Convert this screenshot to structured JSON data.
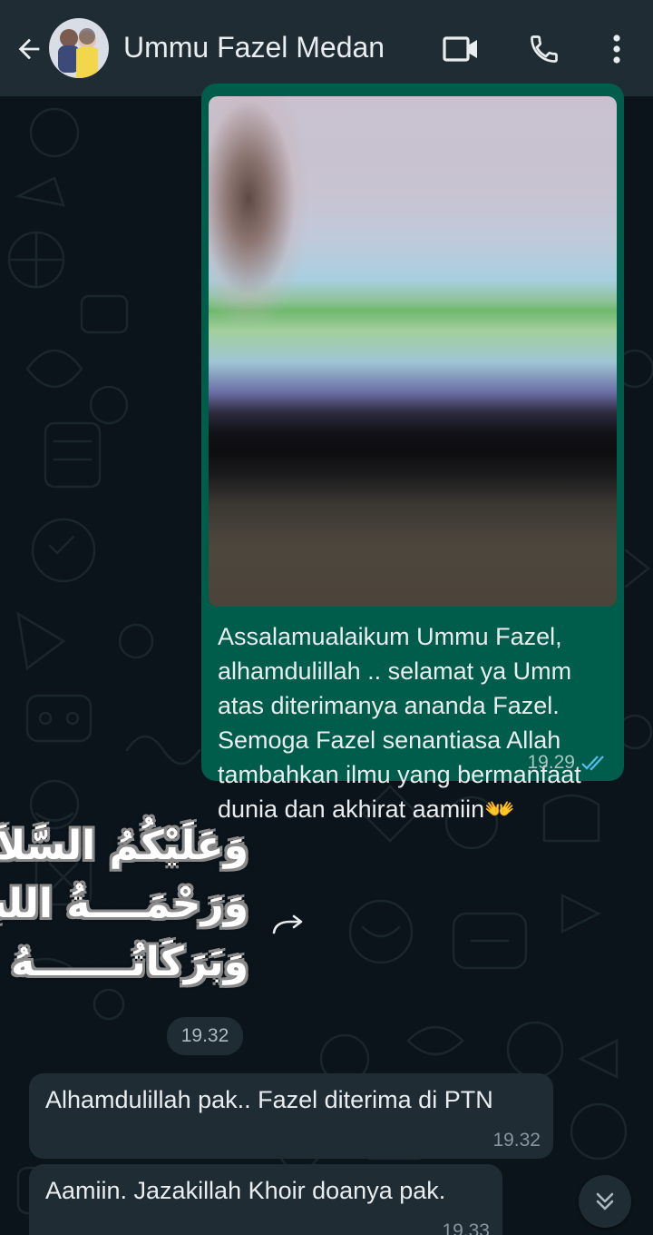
{
  "header": {
    "title": "Ummu Fazel Medan",
    "back_icon": "arrow-left-icon",
    "video_icon": "video-camera-icon",
    "call_icon": "phone-icon",
    "menu_icon": "more-vertical-icon"
  },
  "messages": {
    "outgoing_image": {
      "text": "Assalamualaikum Ummu Fazel, alhamdulillah .. selamat ya Umm atas diterimanya ananda Fazel. Semoga Fazel senantiasa Allah tambahkan ilmu yang bermanfaat dunia dan akhirat aamiin👐",
      "time": "19.29",
      "status": "read"
    },
    "sticker": {
      "line1": "وَعَلَيْكُمُ السَّلاَمُ",
      "line2": "وَرَحْمَــــةُ اللهِ",
      "line3": "وَبَرَكَاتُـــــــهُ",
      "time": "19.32"
    },
    "incoming": [
      {
        "text": "Alhamdulillah pak.. Fazel diterima di PTN",
        "time": "19.32"
      },
      {
        "text": "Aamiin. Jazakillah Khoir doanya pak.",
        "time": "19.33"
      }
    ]
  },
  "colors": {
    "background": "#0b141a",
    "header": "#1f2c34",
    "outgoing_bubble": "#005c4b",
    "incoming_bubble": "#1f2c34",
    "read_ticks": "#53bdeb"
  }
}
